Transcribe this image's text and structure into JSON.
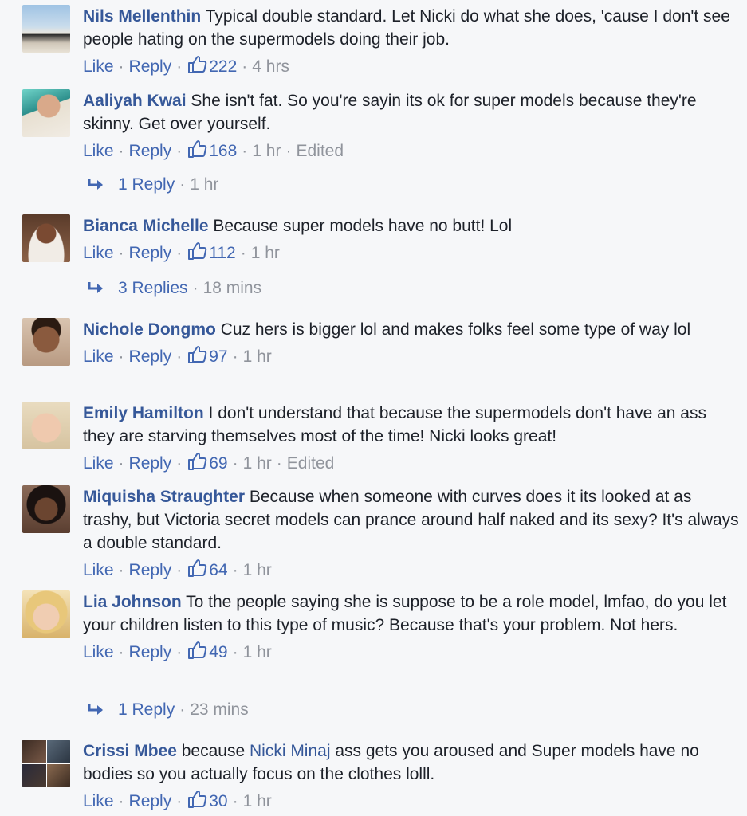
{
  "actions": {
    "like": "Like",
    "reply": "Reply",
    "sep": "·"
  },
  "colors": {
    "link": "#365899",
    "action": "#4267b2",
    "meta": "#90949c",
    "background": "#f6f7f9"
  },
  "comments": [
    {
      "author": "Nils Mellenthin",
      "text": "Typical double standard. Let Nicki do what she does, 'cause I don't see people hating on the supermodels doing their job.",
      "likes": "222",
      "time": "4 hrs",
      "edited": ""
    },
    {
      "author": "Aaliyah Kwai",
      "text": "She isn't fat. So you're sayin its ok for super models because they're skinny. Get over yourself.",
      "likes": "168",
      "time": "1 hr",
      "edited": "Edited",
      "replies_label": "1 Reply",
      "replies_time": "1 hr"
    },
    {
      "author": "Bianca Michelle",
      "text": "Because super models have no butt! Lol",
      "likes": "112",
      "time": "1 hr",
      "edited": "",
      "replies_label": "3 Replies",
      "replies_time": "18 mins"
    },
    {
      "author": "Nichole Dongmo",
      "text": "Cuz hers is bigger lol and makes folks feel some type of way lol",
      "likes": "97",
      "time": "1 hr",
      "edited": ""
    },
    {
      "author": "Emily Hamilton",
      "text": "I don't understand that because the supermodels don't have an ass they are starving themselves most of the time! Nicki looks great!",
      "likes": "69",
      "time": "1 hr",
      "edited": "Edited"
    },
    {
      "author": "Miquisha Straughter",
      "text": "Because when someone with curves does it its looked at as trashy, but Victoria secret models can prance around half naked and its sexy? It's always a double standard.",
      "likes": "64",
      "time": "1 hr",
      "edited": ""
    },
    {
      "author": "Lia Johnson",
      "text": "To the people saying she is suppose to be a role model, lmfao, do you let your children listen to this type of music? Because that's your problem. Not hers.",
      "likes": "49",
      "time": "1 hr",
      "edited": "",
      "replies_label": "1 Reply",
      "replies_time": "23 mins"
    },
    {
      "author": "Crissi Mbee",
      "text_before": "because",
      "mention": "Nicki Minaj",
      "text_after": "ass gets you aroused and Super models have no bodies so you actually focus on the clothes lolll.",
      "likes": "30",
      "time": "1 hr",
      "edited": ""
    }
  ]
}
